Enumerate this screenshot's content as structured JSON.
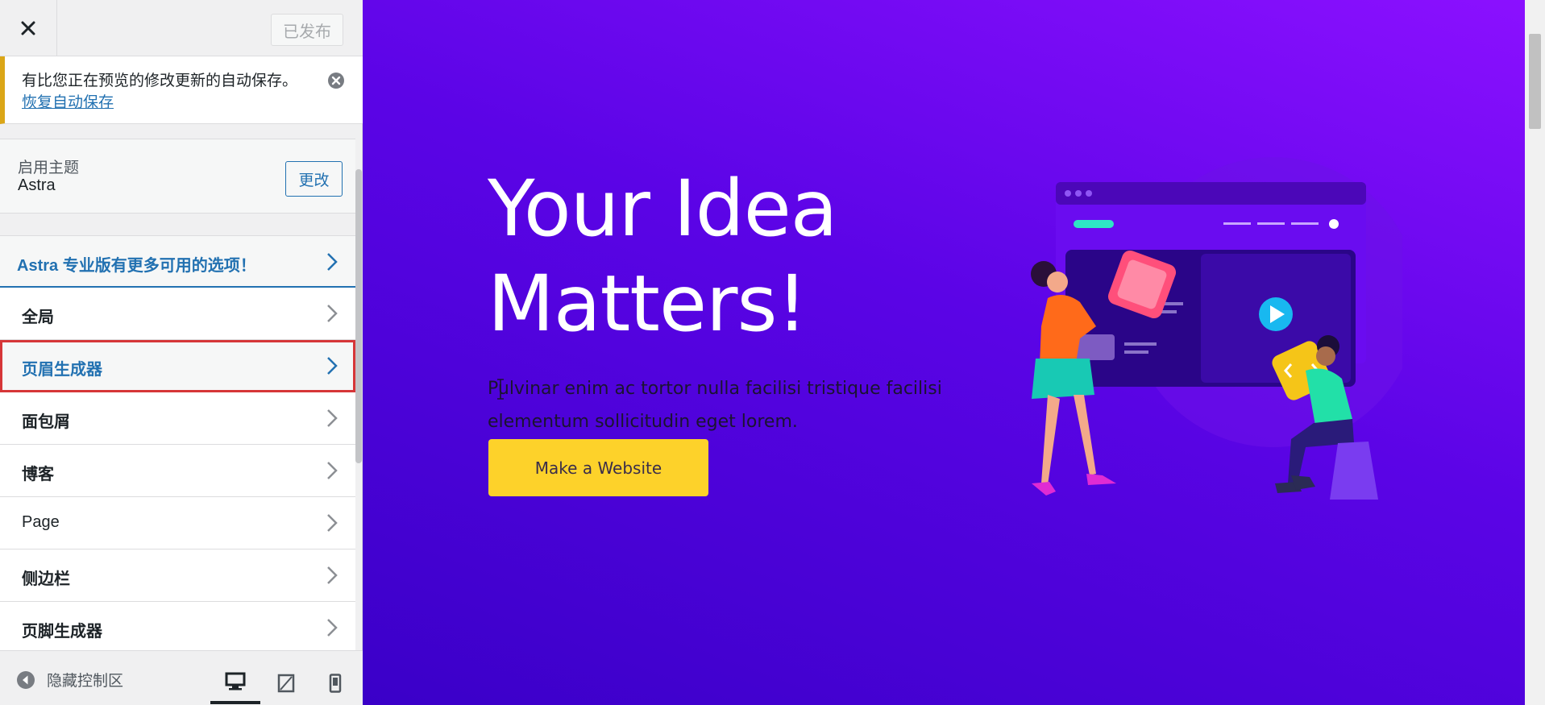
{
  "topbar": {
    "publish_label": "已发布"
  },
  "notice": {
    "text": "有比您正在预览的修改更新的自动保存。",
    "link": "恢复自动保存"
  },
  "theme": {
    "label": "启用主题",
    "name": "Astra",
    "change_label": "更改"
  },
  "menu": {
    "promo": "Astra 专业版有更多可用的选项！",
    "items": [
      {
        "label": "全局"
      },
      {
        "label": "页眉生成器"
      },
      {
        "label": "面包屑"
      },
      {
        "label": "博客"
      },
      {
        "label": "Page"
      },
      {
        "label": "侧边栏"
      },
      {
        "label": "页脚生成器"
      }
    ]
  },
  "footer": {
    "hide_label": "隐藏控制区",
    "devices": [
      "desktop-icon",
      "tablet-icon",
      "mobile-icon"
    ]
  },
  "preview": {
    "title_line1": "Your Idea",
    "title_line2": "Matters!",
    "text": "Pulvinar enim ac tortor nulla facilisi tristique facilisi elementum sollicitudin eget lorem.",
    "button": "Make a Website"
  },
  "colors": {
    "accent": "#2271b1",
    "highlight": "#d63638",
    "warning": "#dba617",
    "cta": "#fdd22a",
    "hero_gradient_top": "#8b10ff",
    "hero_gradient_bottom": "#3a00c8"
  }
}
